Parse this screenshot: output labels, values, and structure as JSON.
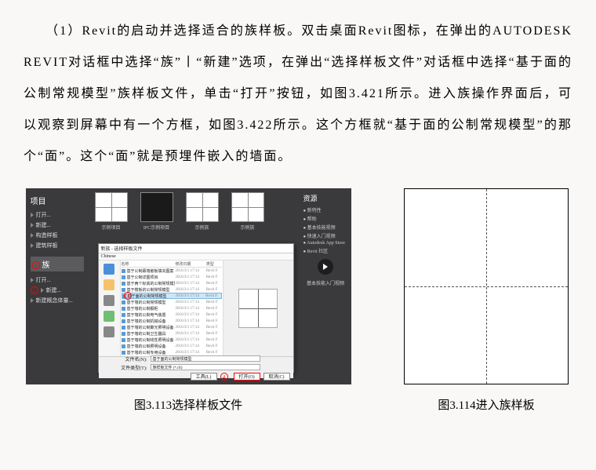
{
  "paragraph": "　　（1）Revit的启动并选择适合的族样板。双击桌面Revit图标，在弹出的AUTODESK REVIT对话框中选择“族”丨“新建”选项，在弹出“选择样板文件”对话框中选择“基于面的公制常规模型”族样板文件，单击“打开”按钮，如图3.421所示。进入族操作界面后，可以观察到屏幕中有一个方框，如图3.422所示。这个方框就“基于面的公制常规模型”的那个“面”。这个“面”就是预埋件嵌入的墙面。",
  "figure_left": {
    "caption": "图3.113选择样板文件",
    "left_panel": {
      "title": "项目",
      "items": [
        "打开...",
        "新建...",
        "构造样板",
        "建筑样板"
      ],
      "family_title": "族",
      "family_items": [
        "打开...",
        "新建...",
        "新建概念体量..."
      ]
    },
    "thumbs": [
      {
        "label": "示例项目"
      },
      {
        "label": "IFC示例项目"
      },
      {
        "label": "示例族"
      },
      {
        "label": "示例族"
      }
    ],
    "dialog": {
      "title": "新族 - 选择样板文件",
      "look_in": "Chinese",
      "columns": [
        "名称",
        "修改日期",
        "类型"
      ],
      "files": [
        {
          "name": "基于公制幕墙嵌板填充图案",
          "date": "2016/3/1 17:14",
          "type": "Revit F"
        },
        {
          "name": "基于公制详图项目",
          "date": "2016/3/1 17:14",
          "type": "Revit F"
        },
        {
          "name": "基于两个标高的公制常规模型",
          "date": "2016/3/1 17:14",
          "type": "Revit F"
        },
        {
          "name": "基于楼板的公制常规模型",
          "date": "2016/3/1 17:14",
          "type": "Revit F"
        },
        {
          "name": "基于面的公制常规模型",
          "date": "2016/3/1 17:14",
          "type": "Revit F",
          "selected": true
        },
        {
          "name": "基于墙的公制常规模型",
          "date": "2016/3/1 17:14",
          "type": "Revit F"
        },
        {
          "name": "基于墙的公制橱柜",
          "date": "2016/3/1 17:14",
          "type": "Revit F"
        },
        {
          "name": "基于墙的公制电气装置",
          "date": "2016/3/1 17:14",
          "type": "Revit F"
        },
        {
          "name": "基于墙的公制机械设备",
          "date": "2016/3/1 17:14",
          "type": "Revit F"
        },
        {
          "name": "基于墙的公制聚光照明设备",
          "date": "2016/3/1 17:14",
          "type": "Revit F"
        },
        {
          "name": "基于墙的公制卫生器具",
          "date": "2016/3/1 17:14",
          "type": "Revit F"
        },
        {
          "name": "基于墙的公制线性照明设备",
          "date": "2016/3/1 17:14",
          "type": "Revit F"
        },
        {
          "name": "基于墙的公制照明设备",
          "date": "2016/3/1 17:14",
          "type": "Revit F"
        },
        {
          "name": "基于墙的公制专用设备",
          "date": "2016/3/1 17:14",
          "type": "Revit F"
        }
      ],
      "filename_label": "文件名(N):",
      "filename_value": "基于面的公制常规模型",
      "filetype_label": "文件类型(T):",
      "filetype_value": "族样板文件 (*.rft)",
      "open_btn": "打开(O)",
      "cancel_btn": "取消(C)",
      "tools_btn": "工具(L)",
      "markers": {
        "one": "1",
        "two": "2",
        "three": "3",
        "four": "4"
      }
    },
    "right_panel": {
      "title": "资源",
      "items": [
        "新特性",
        "帮助",
        "基本技能视频",
        "快速入门视频",
        "Autodesk App Store",
        "Revit 社区"
      ],
      "video_label": "基本技能入门视频"
    }
  },
  "figure_right": {
    "caption": "图3.114进入族样板"
  }
}
